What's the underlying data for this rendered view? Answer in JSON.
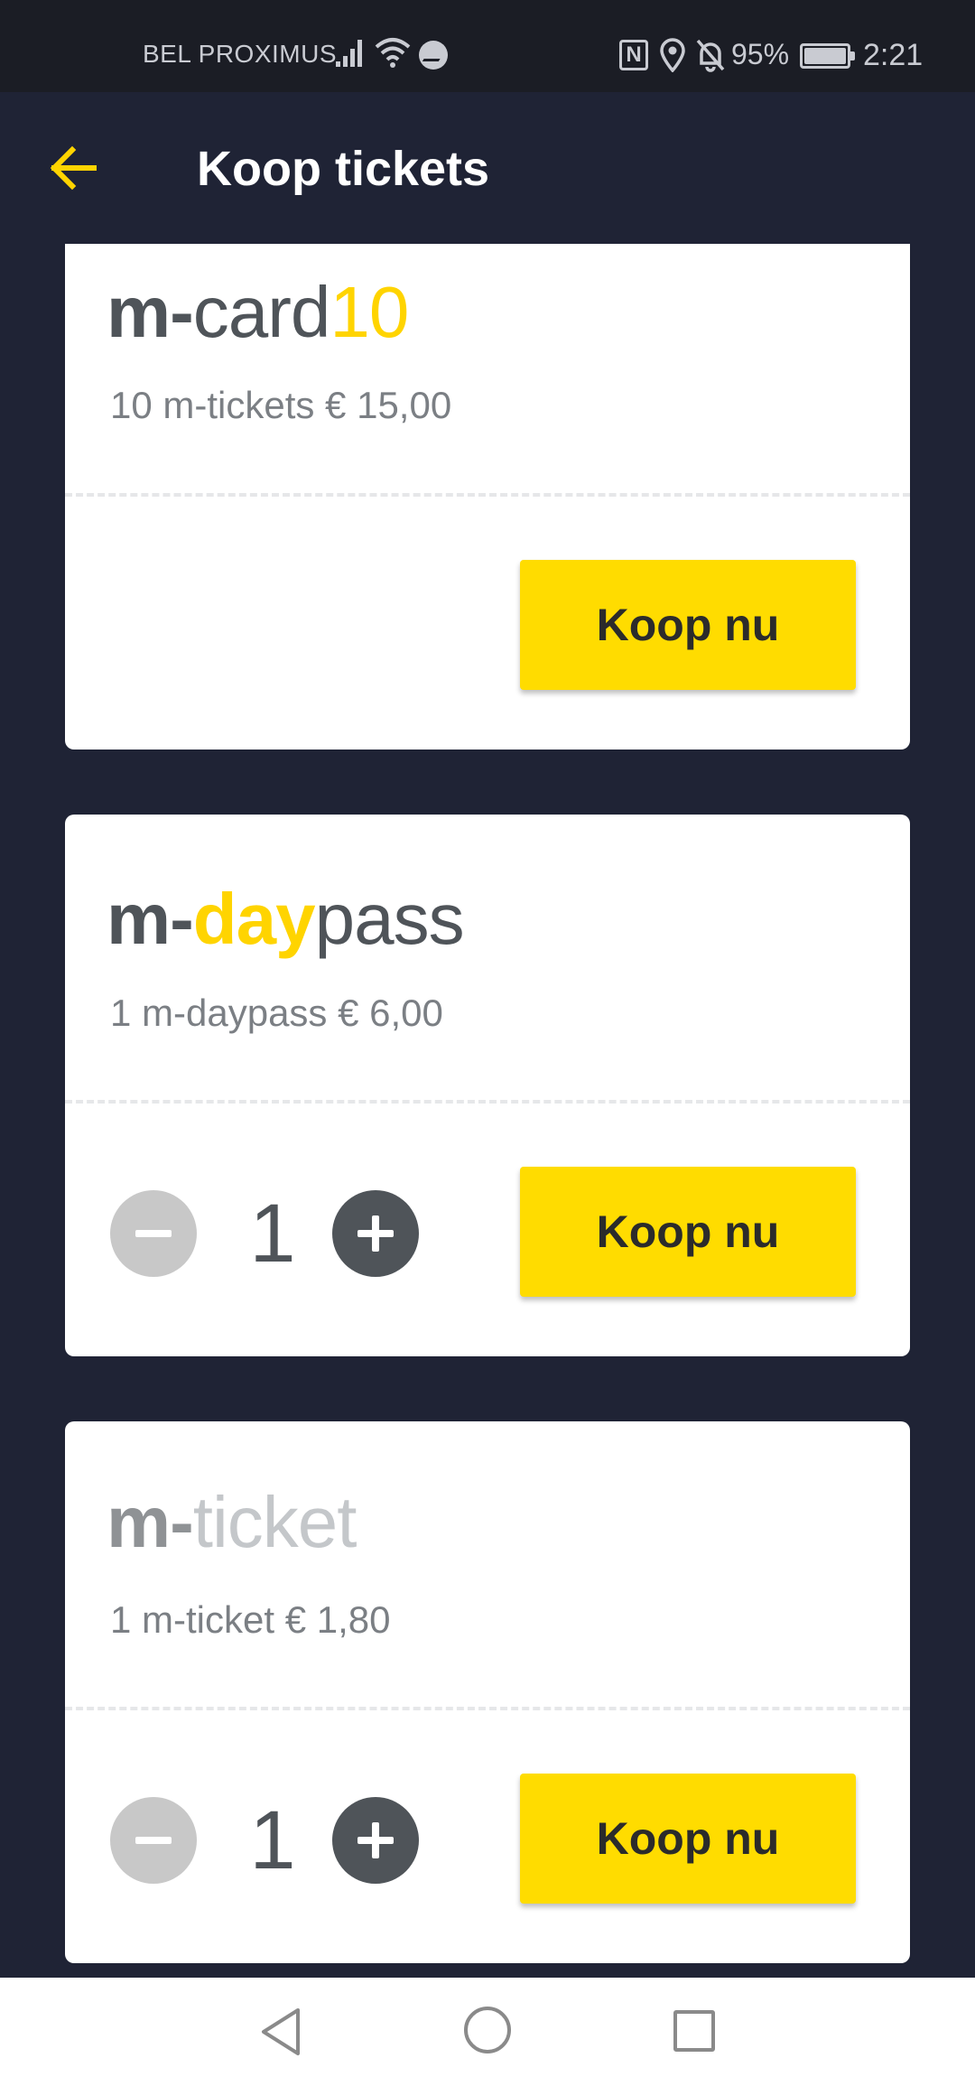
{
  "status_bar": {
    "carrier": "BEL PROXIMUS",
    "battery_percent": "95%",
    "time": "2:21",
    "nfc_label": "N",
    "icons": [
      "signal-icon",
      "wifi-icon",
      "messenger-icon",
      "nfc-icon",
      "location-icon",
      "bell-off-icon",
      "battery-icon"
    ]
  },
  "header": {
    "title": "Koop tickets",
    "back_icon": "arrow-left-icon"
  },
  "tickets": [
    {
      "logo": {
        "prefix": "m-",
        "part1": "card",
        "part2": "10"
      },
      "description": "10 m-tickets  € 15,00",
      "buy_label": "Koop nu"
    },
    {
      "logo": {
        "prefix": "m-",
        "part1": "day",
        "part2": "pass"
      },
      "description": "1 m-daypass  € 6,00",
      "quantity": "1",
      "buy_label": "Koop nu"
    },
    {
      "logo": {
        "prefix": "m-",
        "part1": "ticket"
      },
      "description": "1 m-ticket  € 1,80",
      "quantity": "1",
      "buy_label": "Koop nu"
    }
  ],
  "colors": {
    "background": "#1f2335",
    "accent_yellow": "#ffdc00",
    "logo_grey": "#4f5459",
    "card": "#ffffff"
  },
  "nav_bar": {
    "icons": [
      "nav-back-icon",
      "nav-home-icon",
      "nav-recents-icon"
    ]
  }
}
